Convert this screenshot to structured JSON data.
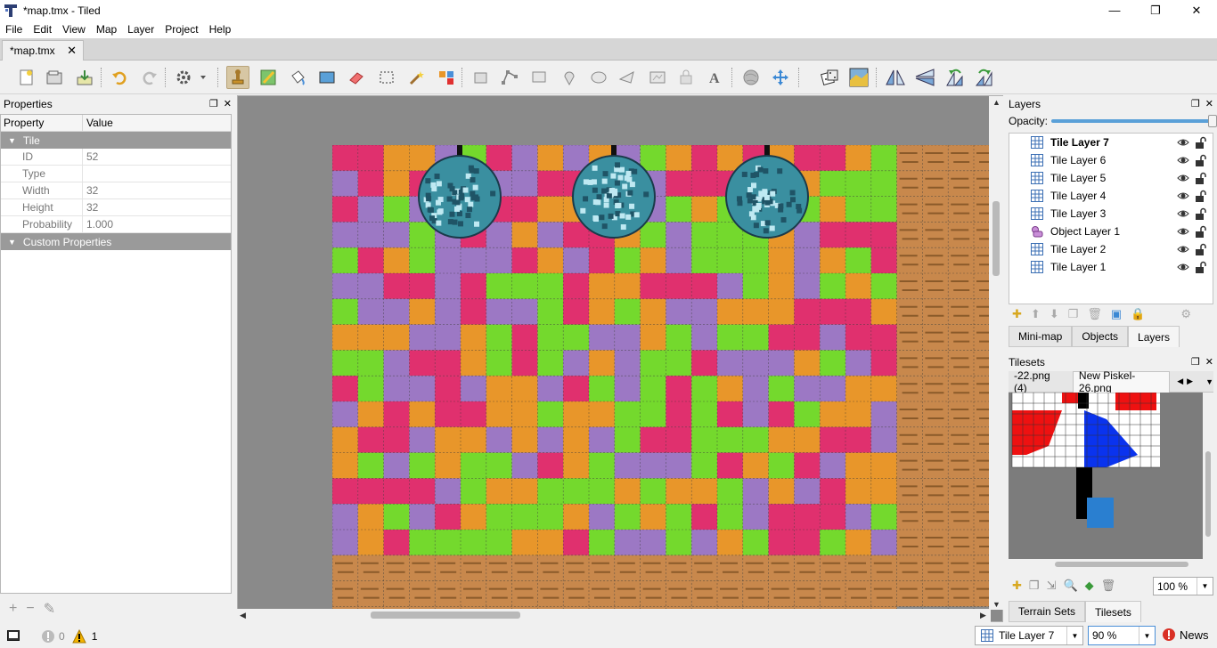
{
  "window": {
    "title": "*map.tmx - Tiled",
    "minimize": "—",
    "restore": "❐",
    "close": "✕"
  },
  "menu": [
    "File",
    "Edit",
    "View",
    "Map",
    "Layer",
    "Project",
    "Help"
  ],
  "document_tab": {
    "label": "*map.tmx",
    "close": "✕"
  },
  "properties": {
    "title": "Properties",
    "header": {
      "property": "Property",
      "value": "Value"
    },
    "group_tile": "Tile",
    "rows": [
      {
        "key": "ID",
        "value": "52"
      },
      {
        "key": "Type",
        "value": ""
      },
      {
        "key": "Width",
        "value": "32"
      },
      {
        "key": "Height",
        "value": "32"
      },
      {
        "key": "Probability",
        "value": "1.000"
      }
    ],
    "group_custom": "Custom Properties"
  },
  "layers_panel": {
    "title": "Layers",
    "opacity_label": "Opacity:",
    "opacity": 1.0,
    "layers": [
      {
        "name": "Tile Layer 7",
        "type": "tile",
        "selected": true
      },
      {
        "name": "Tile Layer 6",
        "type": "tile"
      },
      {
        "name": "Tile Layer 5",
        "type": "tile"
      },
      {
        "name": "Tile Layer 4",
        "type": "tile"
      },
      {
        "name": "Tile Layer 3",
        "type": "tile"
      },
      {
        "name": "Object Layer 1",
        "type": "object"
      },
      {
        "name": "Tile Layer 2",
        "type": "tile"
      },
      {
        "name": "Tile Layer 1",
        "type": "tile"
      }
    ],
    "tabs": [
      "Mini-map",
      "Objects",
      "Layers"
    ]
  },
  "tilesets_panel": {
    "title": "Tilesets",
    "tabs": [
      "-22.png (4)",
      "New Piskel-26.png"
    ],
    "zoom": "100 %",
    "bottom_tabs": [
      "Terrain Sets",
      "Tilesets"
    ]
  },
  "status": {
    "errors": "0",
    "warnings": "1",
    "current_layer": "Tile Layer 7",
    "zoom": "90 %",
    "news": "News"
  },
  "colors": {
    "orange": "#e8962a",
    "green": "#74d92d",
    "pink": "#e0306e",
    "purple": "#9c78c4",
    "wood": "#c8884c",
    "accent": "#3b88d4"
  },
  "icons": {
    "error": "error-circle-icon",
    "warning": "warning-triangle-icon",
    "news": "news-alert-icon"
  }
}
